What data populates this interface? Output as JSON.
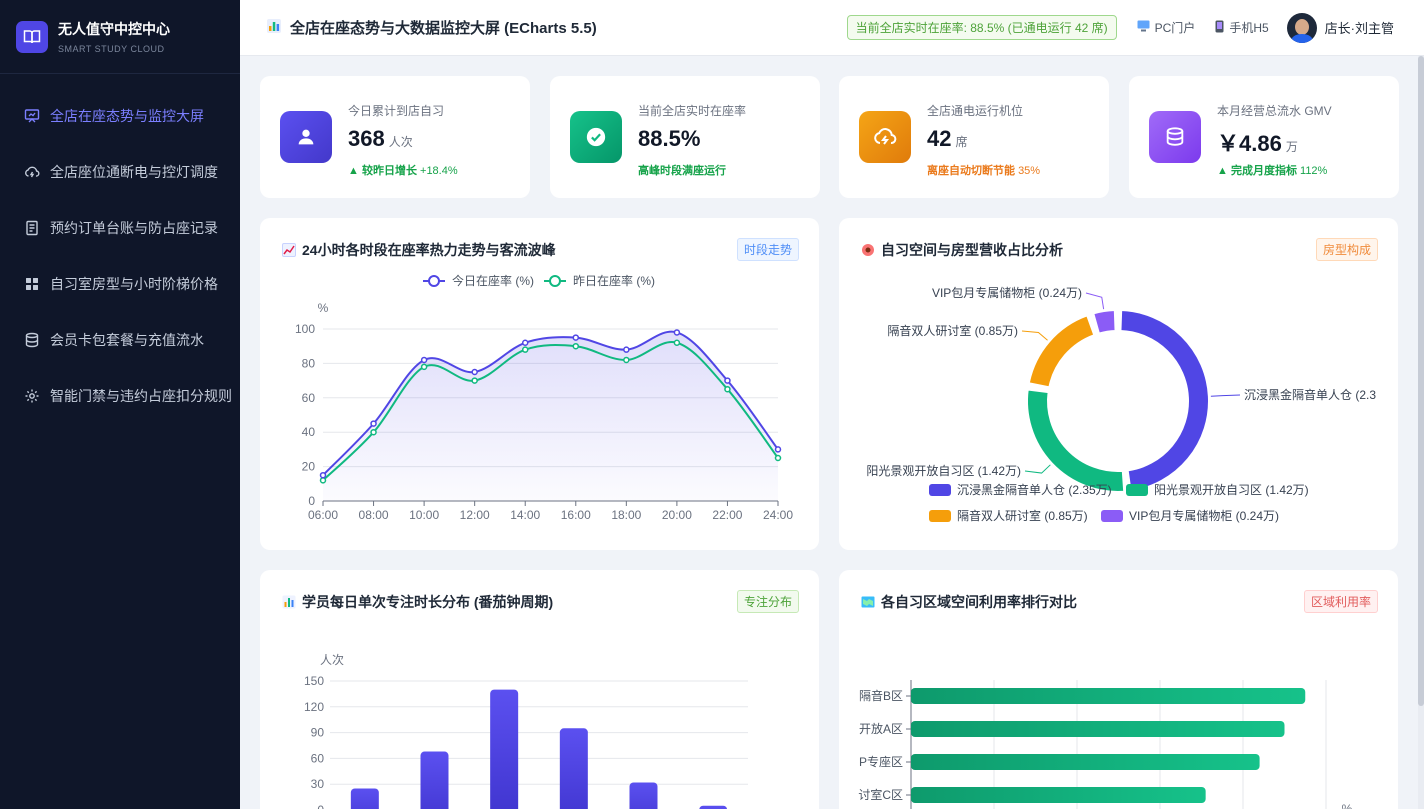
{
  "brand": {
    "title": "无人值守中控中心",
    "subtitle": "SMART STUDY CLOUD"
  },
  "nav": [
    {
      "label": "全店在座态势与监控大屏",
      "icon": "presentation-icon",
      "active": true
    },
    {
      "label": "全店座位通断电与控灯调度",
      "icon": "cloud-power-icon",
      "active": false
    },
    {
      "label": "预约订单台账与防占座记录",
      "icon": "document-icon",
      "active": false
    },
    {
      "label": "自习室房型与小时阶梯价格",
      "icon": "grid-icon",
      "active": false
    },
    {
      "label": "会员卡包套餐与充值流水",
      "icon": "database-icon",
      "active": false
    },
    {
      "label": "智能门禁与违约占座扣分规则",
      "icon": "gear-icon",
      "active": false
    }
  ],
  "header": {
    "title": "全店在座态势与大数据监控大屏 (ECharts 5.5)",
    "status": "当前全店实时在座率: 88.5% (已通电运行 42 席)",
    "link_pc": "PC门户",
    "link_h5": "手机H5",
    "user": "店长·刘主管"
  },
  "stats": [
    {
      "label": "今日累计到店自习",
      "value": "368",
      "unit": "人次",
      "note": "▲ 较昨日增长",
      "note_extra": "+18.4%",
      "color": "#4f46e5",
      "note_color": "#16a34a",
      "icon": "user-icon"
    },
    {
      "label": "当前全店实时在座率",
      "value": "88.5%",
      "unit": "",
      "note": "高峰时段满座运行",
      "note_extra": "",
      "color": "#10b981",
      "note_color": "#16a34a",
      "icon": "check-circle-icon"
    },
    {
      "label": "全店通电运行机位",
      "value": "42",
      "unit": "席",
      "note": "离座自动切断节能",
      "note_extra": "35%",
      "color": "#f59e0b",
      "note_color": "#ea7a1c",
      "icon": "cloud-lightning-icon"
    },
    {
      "label": "本月经营总流水 GMV",
      "value": "￥4.86",
      "unit": "万",
      "note": "▲ 完成月度指标",
      "note_extra": "112%",
      "color": "#8b5cf6",
      "note_color": "#16a34a",
      "icon": "coins-icon"
    }
  ],
  "panels": {
    "line": {
      "title": "24小时各时段在座率热力走势与客流波峰",
      "tag": "时段走势"
    },
    "pie": {
      "title": "自习空间与房型营收占比分析",
      "tag": "房型构成"
    },
    "bar": {
      "title": "学员每日单次专注时长分布 (番茄钟周期)",
      "tag": "专注分布"
    },
    "hbar": {
      "title": "各自习区域空间利用率排行对比",
      "tag": "区域利用率"
    }
  },
  "chart_data": [
    {
      "type": "line",
      "title": "24小时各时段在座率热力走势与客流波峰",
      "ylabel": "%",
      "ylim": [
        0,
        100
      ],
      "y_ticks": [
        "0",
        "20",
        "40",
        "60",
        "80",
        "100"
      ],
      "categories": [
        "06:00",
        "08:00",
        "10:00",
        "12:00",
        "14:00",
        "16:00",
        "18:00",
        "20:00",
        "22:00",
        "24:00"
      ],
      "series": [
        {
          "name": "今日在座率 (%)",
          "color": "#5046e5",
          "values": [
            15,
            45,
            82,
            75,
            92,
            95,
            88,
            98,
            70,
            30
          ]
        },
        {
          "name": "昨日在座率 (%)",
          "color": "#10b981",
          "values": [
            12,
            40,
            78,
            70,
            88,
            90,
            82,
            92,
            65,
            25
          ]
        }
      ],
      "legend": "top-center",
      "grid": true
    },
    {
      "type": "pie",
      "title": "自习空间与房型营收占比分析",
      "slices": [
        {
          "name": "沉浸黑金隔音单人仓",
          "value": 2.35,
          "label": "沉浸黑金隔音单人仓 (2.35万)",
          "color": "#5046e5"
        },
        {
          "name": "阳光景观开放自习区",
          "value": 1.42,
          "label": "阳光景观开放自习区 (1.42万)",
          "color": "#10b981"
        },
        {
          "name": "隔音双人研讨室",
          "value": 0.85,
          "label": "隔音双人研讨室 (0.85万)",
          "color": "#f59e0b"
        },
        {
          "name": "VIP包月专属储物柜",
          "value": 0.24,
          "label": "VIP包月专属储物柜 (0.24万)",
          "color": "#8b5cf6"
        }
      ],
      "outer_labels": [
        "沉浸黑金隔音单人仓 (2.3",
        "阳光景观开放自习区 (1.42万)",
        "隔音双人研讨室 (0.85万)",
        "VIP包月专属储物柜 (0.24万)"
      ],
      "legend": "bottom"
    },
    {
      "type": "bar",
      "title": "学员每日单次专注时长分布 (番茄钟周期)",
      "ylabel": "人次",
      "ylim": [
        0,
        150
      ],
      "y_ticks": [
        "0",
        "30",
        "60",
        "90",
        "120",
        "150"
      ],
      "values": [
        25,
        68,
        140,
        95,
        32,
        5
      ],
      "color": "#5046e5"
    },
    {
      "type": "bar",
      "orientation": "horizontal",
      "title": "各自习区域空间利用率排行对比",
      "categories": [
        "隔音B区",
        "开放A区",
        "P专座区",
        "讨室C区"
      ],
      "values": [
        95,
        90,
        84,
        71
      ],
      "xlabel": "%",
      "color": "#10b981"
    }
  ]
}
